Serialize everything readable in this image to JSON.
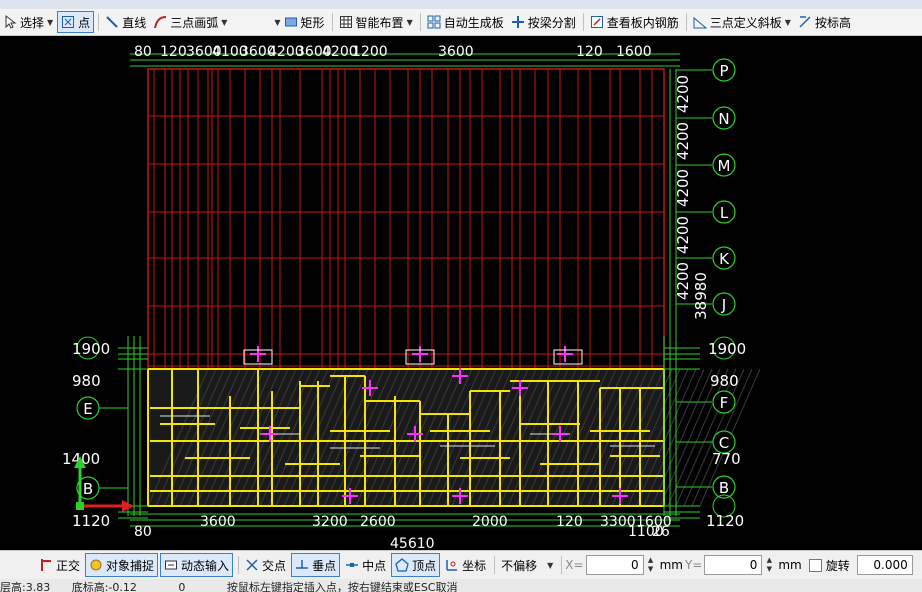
{
  "toolbar": {
    "select": "选择",
    "point": "点",
    "line": "直线",
    "arc": "三点画弧",
    "rect": "矩形",
    "smart": "智能布置",
    "autogen": "自动生成板",
    "beamsplit": "按梁分割",
    "viewrebar": "查看板内钢筋",
    "slope": "三点定义斜板",
    "elevation": "按标高"
  },
  "grid": {
    "right_axes": [
      "P",
      "N",
      "M",
      "L",
      "K",
      "J",
      "F",
      "C",
      "B"
    ],
    "left_axes": [
      "E",
      "B"
    ],
    "right_dims": [
      "4200",
      "4200",
      "4200",
      "4200",
      "4200",
      "38980"
    ],
    "side_values_top": [
      "1900",
      "980"
    ],
    "side_values_bottom": [
      "1120"
    ],
    "right_values_mid": [
      "770"
    ],
    "left_values_mid": [
      "1400"
    ],
    "top_dims": [
      "80",
      "120",
      "3600",
      "4100",
      "3600",
      "4200",
      "3600",
      "4200",
      "1200",
      "3600",
      "120",
      "1600"
    ],
    "bottom_dims": [
      "80",
      "3600",
      "3200",
      "2600",
      "45610",
      "2000",
      "120",
      "3300",
      "1100",
      "26",
      "1600"
    ]
  },
  "status": {
    "ortho": "正交",
    "snap": "对象捕捉",
    "dyn": "动态输入",
    "intersect": "交点",
    "perp": "垂点",
    "mid": "中点",
    "vertex": "顶点",
    "coord": "坐标",
    "offset": "不偏移",
    "x_label": "X=",
    "x_value": "0",
    "mm1": "mm",
    "y_label": "Y=",
    "y_value": "0",
    "mm2": "mm",
    "rotate": "旋转",
    "rotate_value": "0.000"
  },
  "info": {
    "floor_height": "层高:3.83",
    "base_elevation": "底标高:-0.12",
    "zero": "0",
    "hint": "按鼠标左键指定插入点，按右键结束或ESC取消"
  }
}
